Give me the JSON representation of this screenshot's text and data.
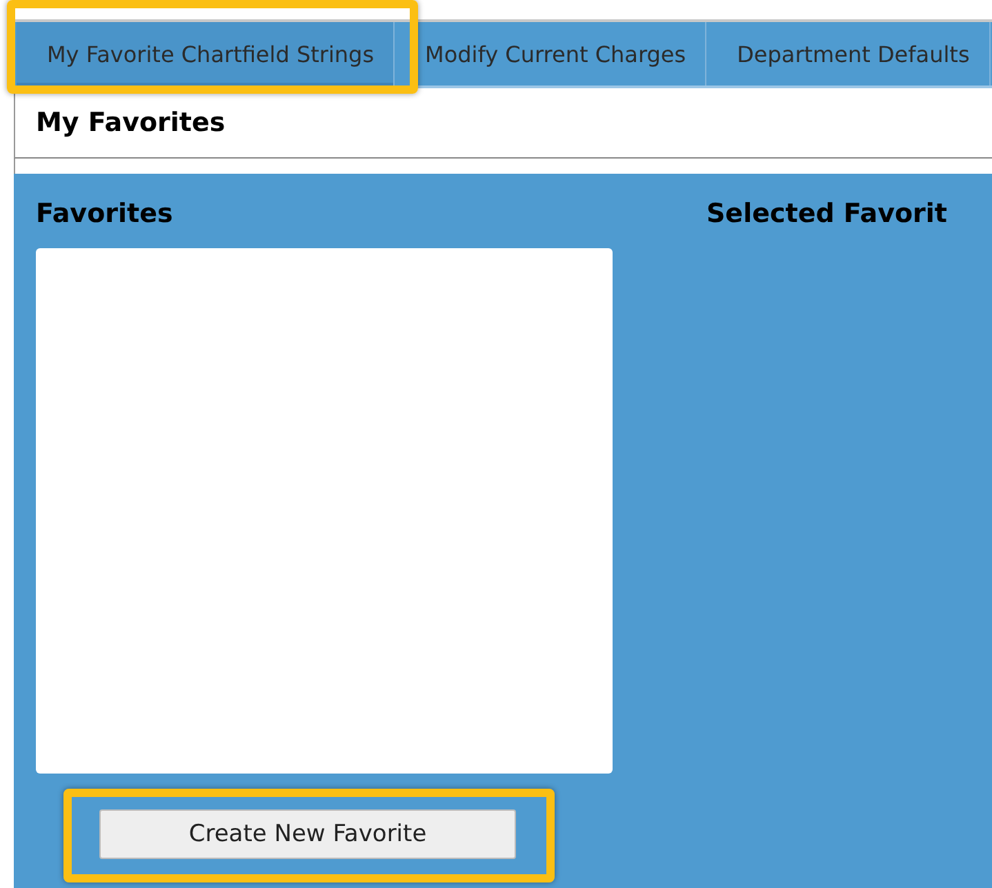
{
  "tabs": [
    {
      "label": "My Favorite Chartfield Strings",
      "selected": true
    },
    {
      "label": "Modify Current Charges",
      "selected": false
    },
    {
      "label": "Department Defaults",
      "selected": false
    }
  ],
  "page_title": "My Favorites",
  "favorites": {
    "heading": "Favorites"
  },
  "selected_favorite": {
    "heading": "Selected Favorit"
  },
  "create_button": "Create New Favorite"
}
